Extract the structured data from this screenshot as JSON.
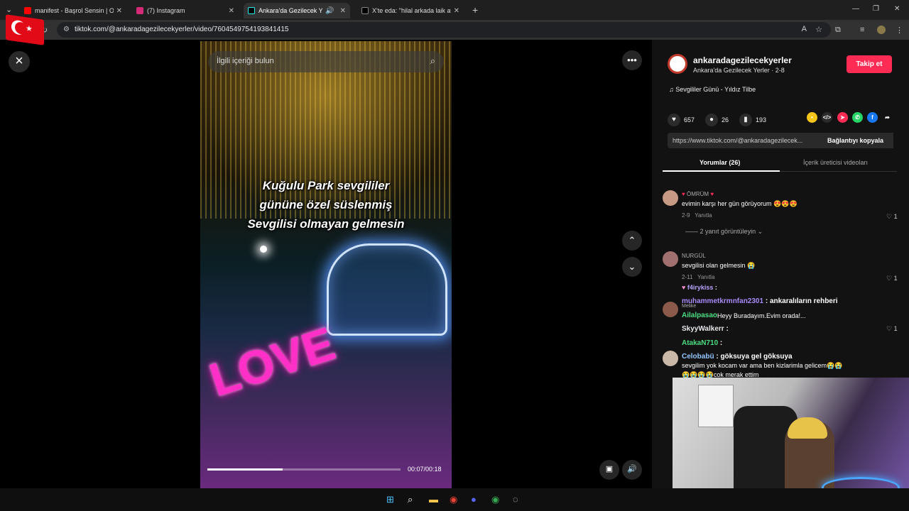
{
  "tabs": [
    {
      "title": "manifest - Başrol Sensin | Offici",
      "fav_color": "#ff0000"
    },
    {
      "title": "(7) Instagram",
      "fav_color": "#d62976"
    },
    {
      "title": "Ankara'da Gezilecek Yerler",
      "fav_color": "#000000"
    },
    {
      "title": "X'te eda: \"hilal arkada laik atak",
      "fav_color": "#000000"
    }
  ],
  "address": {
    "url": "tiktok.com/@ankaradagezilecekyerler/video/7604549754193841415"
  },
  "video": {
    "search_placeholder": "İlgili içeriği bulun",
    "caption_lines": [
      "Kuğulu Park sevgililer",
      "gününe özel süslenmiş",
      "Sevgilisi olmayan gelmesin"
    ],
    "sign_text": "LOVE",
    "time": "00:07/00:18",
    "progress": 0.39
  },
  "creator": {
    "username": "ankaradagezilecekyerler",
    "display": "Ankara'da Gezilecek Yerler · 2-8",
    "follow_label": "Takip et",
    "music": "Sevgililer Günü - Yıldız Tilbe"
  },
  "stats": {
    "likes": "657",
    "comments": "26",
    "saves": "193"
  },
  "link": {
    "url": "https://www.tiktok.com/@ankaradagezilecek...",
    "copy_label": "Bağlantıyı kopyala"
  },
  "panel_tabs": {
    "comments": "Yorumlar (26)",
    "creator_videos": "İçerik üreticisi videoları"
  },
  "comments": [
    {
      "user": "ÖMRÜM",
      "text": "evimin karşı her gün görüyorum 😍😍😍",
      "date": "2-9",
      "reply": "Yanıtla",
      "likes": "1",
      "view_replies": "2 yanıt görüntüleyin"
    },
    {
      "user": "NURGÜL",
      "text": "sevgilisi olan gelmesin 😭",
      "date": "2-11",
      "reply": "Yanıtla",
      "likes": "1"
    },
    {
      "user": "Melike",
      "text": "Heyy Buradayım.Evim orada!...",
      "likes": "1"
    },
    {
      "user": "Celobabü",
      "text": "sevgilim yok kocam var ama ben kizlarimla gelicem😭😭",
      "extra": "😭😭😭😭cok merak ettim"
    }
  ],
  "chat": [
    {
      "user": "f4irykiss",
      "text": "",
      "color": "#b9a3ff"
    },
    {
      "user": "muhammetkrmnfan2301",
      "text": "ankaralıların rehberi",
      "color": "#a78bfa"
    },
    {
      "user": "Ailalpasao",
      "text": "",
      "color": "#4ade80"
    },
    {
      "user": "SkyyWalkerr",
      "text": "",
      "color": "#e5e7eb"
    },
    {
      "user": "AtakaN710",
      "text": "",
      "color": "#4ade80"
    },
    {
      "user": "Celobabü",
      "text": "göksuya gel göksuya",
      "color": "#93c5fd"
    }
  ],
  "colors": {
    "accent": "#fe2c55",
    "panel_bg": "#121212"
  }
}
